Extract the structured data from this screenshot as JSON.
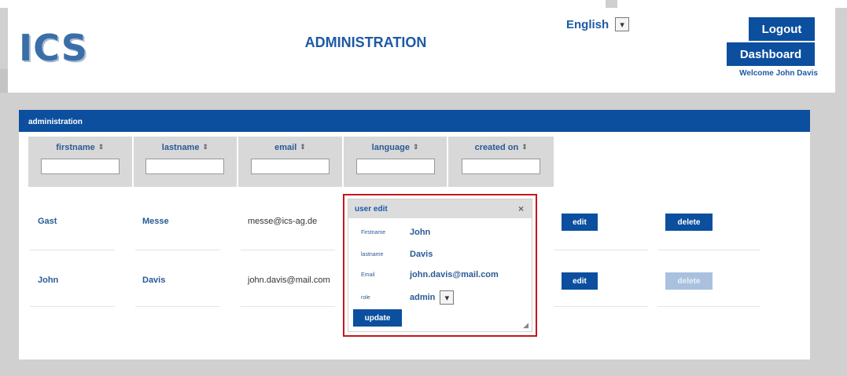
{
  "header": {
    "logo": "ICS",
    "title": "ADMINISTRATION",
    "language": "English",
    "logout_label": "Logout",
    "dashboard_label": "Dashboard",
    "welcome": "Welcome John Davis"
  },
  "panel": {
    "title": "administration",
    "columns": [
      "firstname",
      "lastname",
      "email",
      "language",
      "created on"
    ],
    "sort_glyph": "⇕",
    "rows": [
      {
        "firstname": "Gast",
        "lastname": "Messe",
        "email": "messe@ics-ag.de",
        "edit": "edit",
        "delete": "delete"
      },
      {
        "firstname": "John",
        "lastname": "Davis",
        "email": "john.davis@mail.com",
        "edit": "edit",
        "delete": "delete"
      }
    ]
  },
  "modal": {
    "title": "user edit",
    "close": "×",
    "fields": {
      "firstname_label": "Firstname",
      "firstname_value": "John",
      "lastname_label": "lastname",
      "lastname_value": "Davis",
      "email_label": "Email",
      "email_value": "john.davis@mail.com",
      "role_label": "role",
      "role_value": "admin"
    },
    "update_label": "update"
  },
  "colors": {
    "brand_blue": "#0b4f9e",
    "highlight_red": "#c4161c"
  }
}
